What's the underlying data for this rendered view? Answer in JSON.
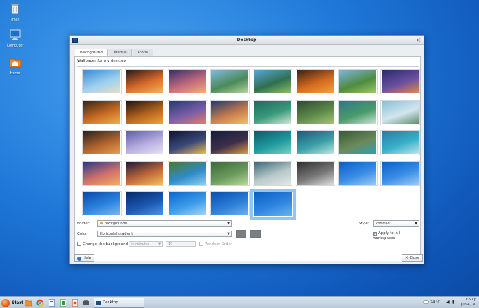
{
  "desktop": {
    "icons": [
      {
        "label": "Trash"
      },
      {
        "label": "Computer"
      },
      {
        "label": "Home"
      }
    ]
  },
  "window": {
    "title": "Desktop",
    "tabs": [
      {
        "label": "Background",
        "active": true
      },
      {
        "label": "Menus",
        "active": false
      },
      {
        "label": "Icons",
        "active": false
      }
    ],
    "section_label": "Wallpaper for my desktop",
    "folder_label": "Folder:",
    "folder_value": "backgrounds",
    "color_label": "Color:",
    "color_value": "Horizontal gradient",
    "style_label": "Style:",
    "style_value": "Zoomed",
    "apply_all_label": "Apply to all workspaces",
    "change_bg_label": "Change the background",
    "interval_value": "in minutes",
    "interval_number": "10",
    "random_label": "Random Order",
    "help_label": "Help",
    "close_label": "Close",
    "color_swatches": [
      "#7a7f84",
      "#7a7f84"
    ]
  },
  "thumbnails": [
    [
      "#3c8dd6",
      "#9fd0ef",
      "#e8e0c4"
    ],
    [
      "#2b1a1a",
      "#d76b2a",
      "#f4b45e"
    ],
    [
      "#3a2f6b",
      "#c26a7c",
      "#f5b07a"
    ],
    [
      "#7fb7de",
      "#4a8a58",
      "#b7d5a0"
    ],
    [
      "#5aa3d8",
      "#2f6f4f",
      "#8fbf6a"
    ],
    [
      "#3b2416",
      "#d56a1e",
      "#f3a33c"
    ],
    [
      "#7bb4da",
      "#4e8b3f",
      "#a0c86a"
    ],
    [
      "#2a2b6e",
      "#6b4fa0",
      "#e08a4a"
    ],
    [
      "#3a2416",
      "#c76a22",
      "#f0b04c"
    ],
    [
      "#1f140e",
      "#b4641e",
      "#f0a23c"
    ],
    [
      "#283a6e",
      "#7a5ea8",
      "#e27d67"
    ],
    [
      "#243a6a",
      "#c77b4e",
      "#f4c06a"
    ],
    [
      "#1f6a5e",
      "#3a9a7a",
      "#cfe8d8"
    ],
    [
      "#2f4a32",
      "#5e8a4a",
      "#a4c47a"
    ],
    [
      "#2c7a86",
      "#4a9a6a",
      "#cde4d4"
    ],
    [
      "#8abfd8",
      "#d2e6ee",
      "#5f8d6a"
    ],
    [
      "#2a2320",
      "#b0642c",
      "#e8a050"
    ],
    [
      "#5f5ea8",
      "#b6aee0",
      "#e8e4f2"
    ],
    [
      "#0f1530",
      "#3c4a7a",
      "#f2c04a"
    ],
    [
      "#151e3a",
      "#3e2f4a",
      "#e0a040"
    ],
    [
      "#0f5a6a",
      "#1f9a9e",
      "#7ad0c4"
    ],
    [
      "#1f5a7a",
      "#3aa0a8",
      "#c4e6e0"
    ],
    [
      "#3a5a3a",
      "#6b8a5a",
      "#2aa0b8"
    ],
    [
      "#2a7aa8",
      "#38b0c8",
      "#bfe4f0"
    ],
    [
      "#2a3a8a",
      "#d0706a",
      "#f2b060"
    ],
    [
      "#1e1a3a",
      "#c0683a",
      "#f0c060"
    ],
    [
      "#4a7a2a",
      "#2f8ac8",
      "#8ad0f0"
    ],
    [
      "#3a6a3a",
      "#6a9a5a",
      "#b8d8a0"
    ],
    [
      "#3a6a7a",
      "#b8c8c8",
      "#e0e8ea"
    ],
    [
      "#303030",
      "#777777",
      "#dddddd"
    ],
    [
      "#0b5fc4",
      "#3a8ee6",
      "#9cc8f4"
    ],
    [
      "#0b5fc4",
      "#3a8ee6",
      "#9cc8f4"
    ],
    [
      "#0a4aa8",
      "#2c84e0",
      "#7ab6f0"
    ],
    [
      "#062a6a",
      "#1a58b0",
      "#4a94e8"
    ],
    [
      "#0c68d0",
      "#3c9ce8",
      "#a6d2f6"
    ],
    [
      "#0a4fb0",
      "#2a7ed8",
      "#6ab0f0"
    ],
    [
      "#0b5fc4",
      "#2f86e0",
      "#6cb4f2"
    ]
  ],
  "taskbar": {
    "start_label": "Start",
    "task_label": "Desktop",
    "tray_temp": "24 °C",
    "tray_time": "1:50 p",
    "tray_date": "Jun 4, 20"
  }
}
